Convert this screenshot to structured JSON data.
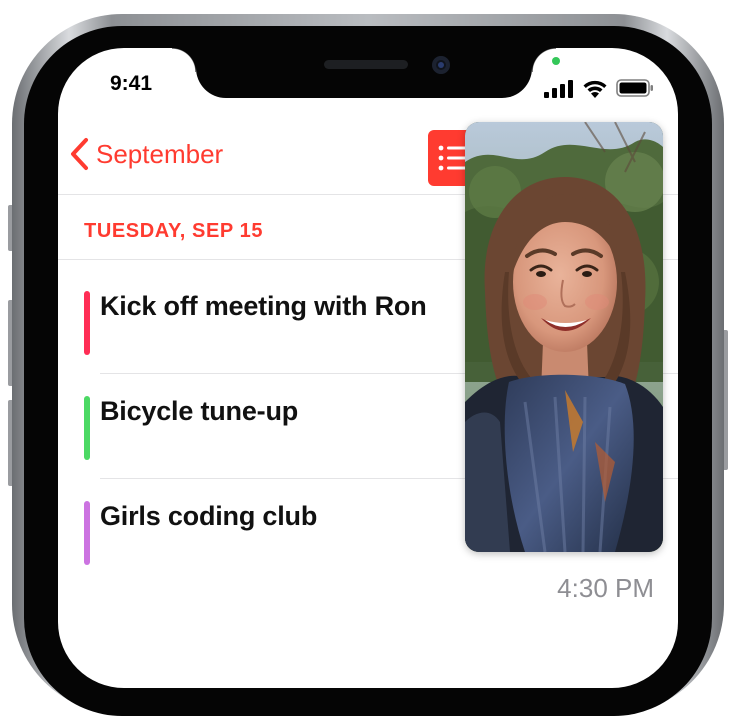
{
  "status_bar": {
    "time": "9:41",
    "signal_icon": "cellular-signal-icon",
    "wifi_icon": "wifi-icon",
    "battery_icon": "battery-icon",
    "privacy_indicator_color": "#34c759"
  },
  "nav": {
    "back_label": "September",
    "back_icon": "chevron-left-icon",
    "list_icon": "list-view-icon",
    "accent_color": "#ff3b30"
  },
  "day": {
    "header": "TUESDAY, SEP 15"
  },
  "events": [
    {
      "title": "Kick off meeting with Ron",
      "color": "#ff2d55"
    },
    {
      "title": "Bicycle tune-up",
      "color": "#4cd964"
    },
    {
      "title": "Girls coding club",
      "color": "#cc73e1",
      "time": "4:30 PM"
    }
  ],
  "pip": {
    "type": "facetime-video-call-thumbnail"
  }
}
